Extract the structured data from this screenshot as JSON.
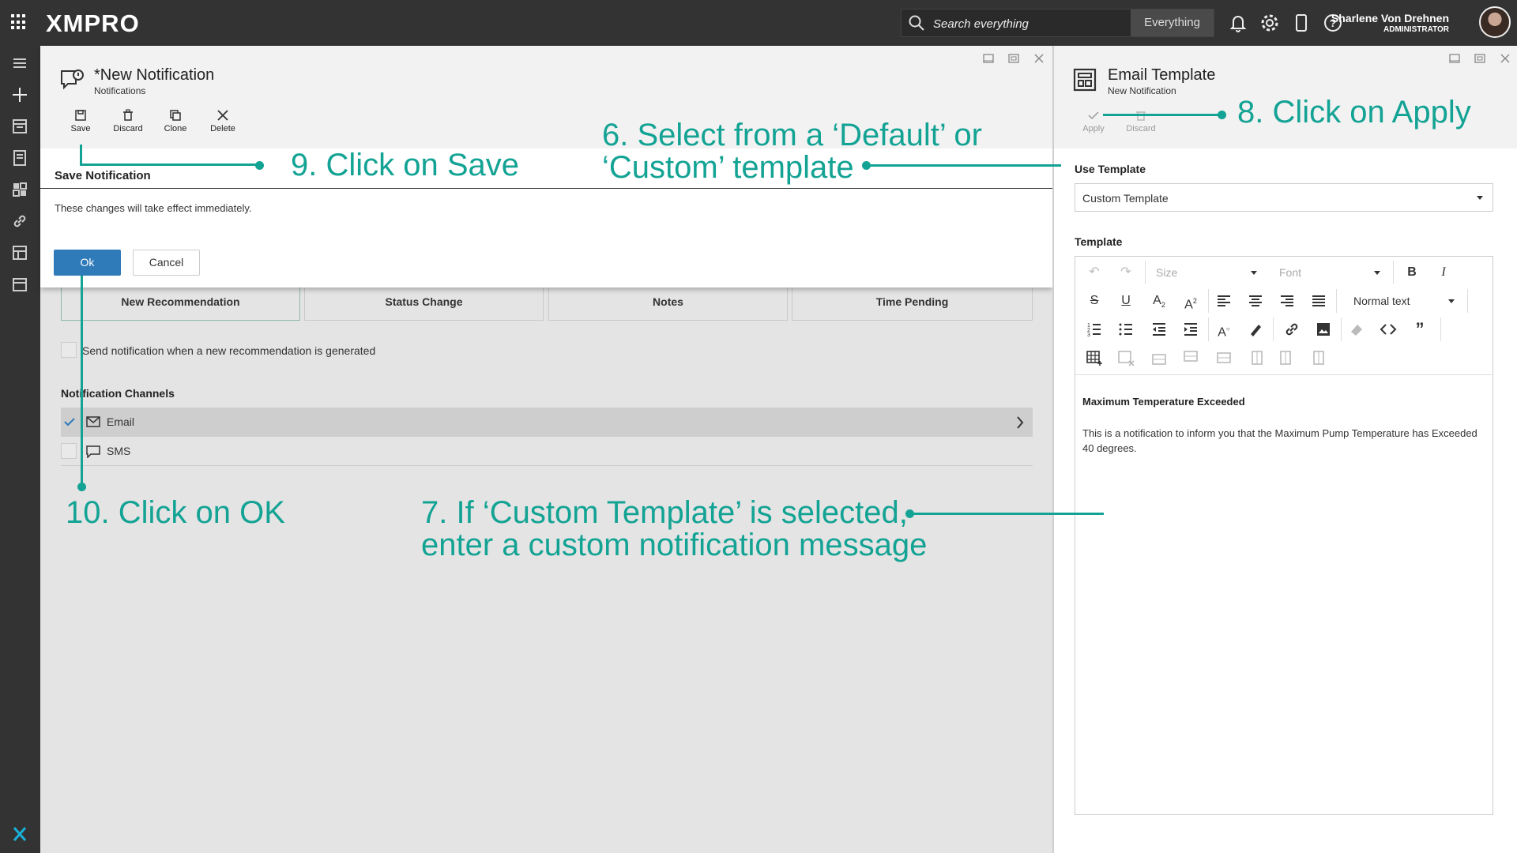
{
  "topbar": {
    "logo": "XMPRO",
    "search_placeholder": "Search everything",
    "search_scope": "Everything",
    "user_name": "Sharlene Von Drehnen",
    "user_role": "ADMINISTRATOR"
  },
  "dialog": {
    "title": "*New Notification",
    "subtitle": "Notifications",
    "tools": [
      "Save",
      "Discard",
      "Clone",
      "Delete"
    ],
    "confirm_title": "Save Notification",
    "confirm_message": "These changes will take effect immediately.",
    "ok_label": "Ok",
    "cancel_label": "Cancel"
  },
  "main": {
    "tabs": [
      "New Recommendation",
      "Status Change",
      "Notes",
      "Time Pending"
    ],
    "send_label": "Send notification when a new recommendation is generated",
    "channels_title": "Notification Channels",
    "channels": [
      {
        "label": "Email",
        "checked": true
      },
      {
        "label": "SMS",
        "checked": false
      }
    ]
  },
  "panel": {
    "title": "Email Template",
    "subtitle": "New Notification",
    "tools": [
      "Apply",
      "Discard"
    ],
    "use_template_label": "Use Template",
    "use_template_value": "Custom Template",
    "template_label": "Template",
    "toolbar": {
      "size": "Size",
      "font": "Font",
      "format": "Normal text"
    },
    "content_heading": "Maximum Temperature Exceeded",
    "content_body": "This is a notification to inform you that the Maximum Pump Temperature has Exceeded 40 degrees."
  },
  "annotations": {
    "step6_line1": "6. Select from a ‘Default’ or",
    "step6_line2": "‘Custom’ template",
    "step7_line1": "7. If ‘Custom Template’ is selected,",
    "step7_line2": "enter a custom notification message",
    "step8": "8. Click on Apply",
    "step9": "9. Click on Save",
    "step10": "10. Click on OK"
  },
  "colors": {
    "accent": "#13a394",
    "primary_button": "#2f7ab8",
    "topbar": "#333333"
  }
}
